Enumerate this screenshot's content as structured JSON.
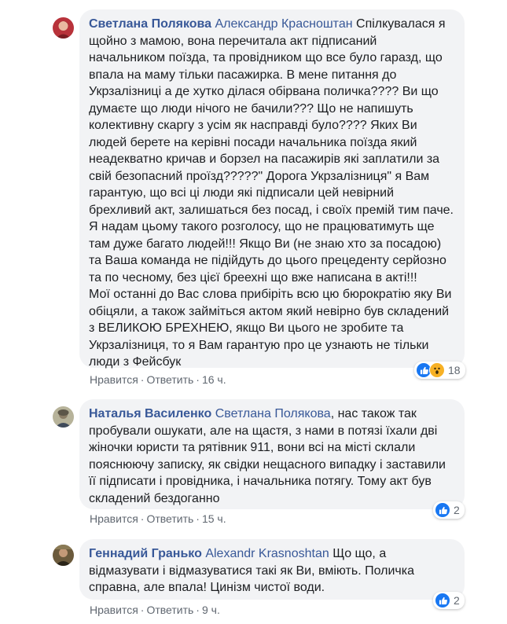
{
  "comments": [
    {
      "author": "Светлана Полякова",
      "mention": "Александр Красноштан",
      "text": " Спілкувалася я щойно з мамою, вона перечитала акт підписаний начальником поїзда, та провідником що все було гаразд, що впала на маму тільки пасажирка. В мене питання до Укрзалізниці а де хутко ділася обірвана поличка???? Ви що думаєте що люди нічого не бачили??? Що не напишуть колективну скаргу з усім як насправді було???? Яких Ви людей берете на керівні посади начальника поїзда який неадекватно кричав и борзел на пасажирів які заплатили за свій безопасний проїзд?????\" Дорога Укрзалізниця\" я Вам гарантую, що всі ці люди які підписали цей невірний брехливий акт, залишаться без посад, і своїх премій тим паче. Я надам цьому такого розголосу, що не працюватимуть ще там дуже багато людей!!! Якщо Ви (не знаю хто за посадою) та Ваша команда не підійдуть до цього прецеденту серйозно та по чесному, без цієї бреехні що вже написана в акті!!!\nМої останні до Вас слова прибіріть всю цю бюрократію яку Ви обіцяли, а також займіться актом який невірно був складений з ВЕЛИКОЮ БРЕХНЕЮ, якщо Ви цього не зробите та Укрзалізниця, то я Вам гарантую про це узнають не тільки люди з Фейсбук",
      "like_label": "Нравится",
      "reply_label": "Ответить",
      "time": "16 ч.",
      "reaction_count": "18",
      "reaction_icons": [
        "like-icon",
        "wow-icon"
      ]
    },
    {
      "author": "Наталья Василенко",
      "mention": "Светлана Полякова",
      "text": ", нас також так пробували ошукати, але на щастя, з нами в потязі їхали дві жіночки юристи та рятівник 911, вони всі на місті склали пояснюючу записку, як свідки нещасного випадку і заставили її підписати і провідника, і начальника потягу. Тому акт був складений бездоганно",
      "like_label": "Нравится",
      "reply_label": "Ответить",
      "time": "15 ч.",
      "reaction_count": "2",
      "reaction_icons": [
        "like-icon"
      ]
    },
    {
      "author": "Геннадий Гранько",
      "mention": "Alexandr Krasnoshtan",
      "text": " Що що, а відмазувати і відмазуватися такі як Ви, вміють. Поличка справна, але впала! Цинізм чистої води.",
      "like_label": "Нравится",
      "reply_label": "Ответить",
      "time": "9 ч.",
      "reaction_count": "2",
      "reaction_icons": [
        "like-icon"
      ]
    }
  ],
  "colors": {
    "name_link": "#385898",
    "bubble_bg": "#f2f3f5",
    "meta_text": "#606770",
    "like_blue": "#1877f2",
    "wow_yellow": "#f7b125"
  }
}
